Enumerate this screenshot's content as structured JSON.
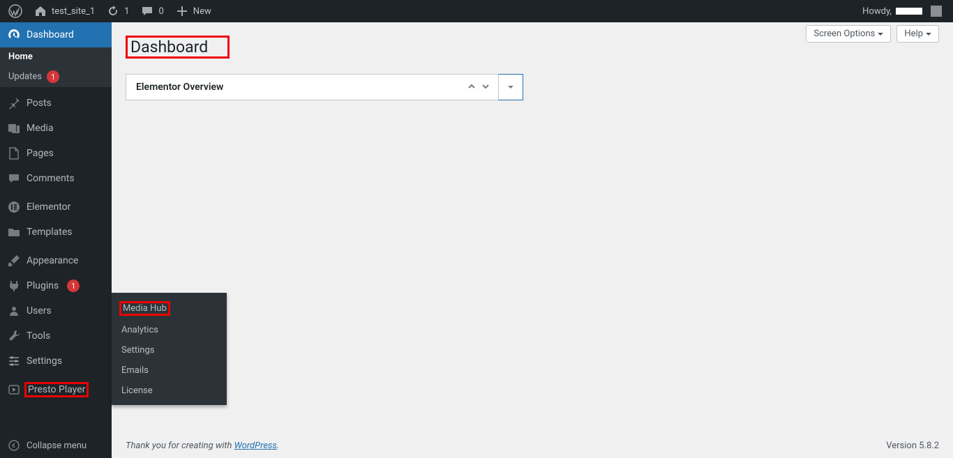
{
  "adminbar": {
    "site_name": "test_site_1",
    "updates_count": "1",
    "comments_count": "0",
    "new_label": "New",
    "howdy": "Howdy,"
  },
  "sidebar": {
    "dashboard_label": "Dashboard",
    "home_label": "Home",
    "updates_label": "Updates",
    "updates_badge": "1",
    "posts_label": "Posts",
    "media_label": "Media",
    "pages_label": "Pages",
    "comments_label": "Comments",
    "elementor_label": "Elementor",
    "templates_label": "Templates",
    "appearance_label": "Appearance",
    "plugins_label": "Plugins",
    "plugins_badge": "1",
    "users_label": "Users",
    "tools_label": "Tools",
    "settings_label": "Settings",
    "presto_label": "Presto Player",
    "collapse_label": "Collapse menu"
  },
  "flyout": {
    "media_hub": "Media Hub",
    "analytics": "Analytics",
    "settings": "Settings",
    "emails": "Emails",
    "license": "License"
  },
  "page": {
    "title": "Dashboard",
    "screen_options": "Screen Options",
    "help": "Help",
    "metabox_title": "Elementor Overview"
  },
  "footer": {
    "text_prefix": "Thank you for creating with ",
    "link_text": "WordPress",
    "link_suffix": ".",
    "version": "Version 5.8.2"
  }
}
